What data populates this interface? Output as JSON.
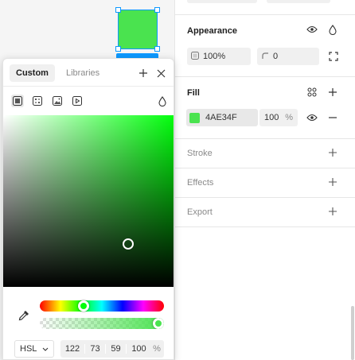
{
  "canvas": {
    "frame_color": "#4AE34F"
  },
  "panel": {
    "appearance": {
      "title": "Appearance",
      "opacity": "100%",
      "corner_radius": "0"
    },
    "fill": {
      "title": "Fill",
      "hex": "4AE34F",
      "opacity": "100",
      "unit": "%",
      "color": "#4AE34F"
    },
    "stroke": {
      "title": "Stroke"
    },
    "effects": {
      "title": "Effects"
    },
    "export": {
      "title": "Export"
    }
  },
  "picker": {
    "tabs": [
      {
        "label": "Custom",
        "active": true
      },
      {
        "label": "Libraries",
        "active": false
      }
    ],
    "fill_types": [
      "solid-paint-icon",
      "gradient-icon",
      "image-icon",
      "video-icon"
    ],
    "mode": "HSL",
    "h": "122",
    "s": "73",
    "l": "59",
    "alpha": "100",
    "alpha_unit": "%",
    "hue_color": "#00ff0b",
    "hue_position": 0.34,
    "alpha_position": 1.0,
    "saturation_position": 0.73,
    "lightness_position": 0.59
  },
  "colors": {
    "accent": "#0d99ff"
  }
}
